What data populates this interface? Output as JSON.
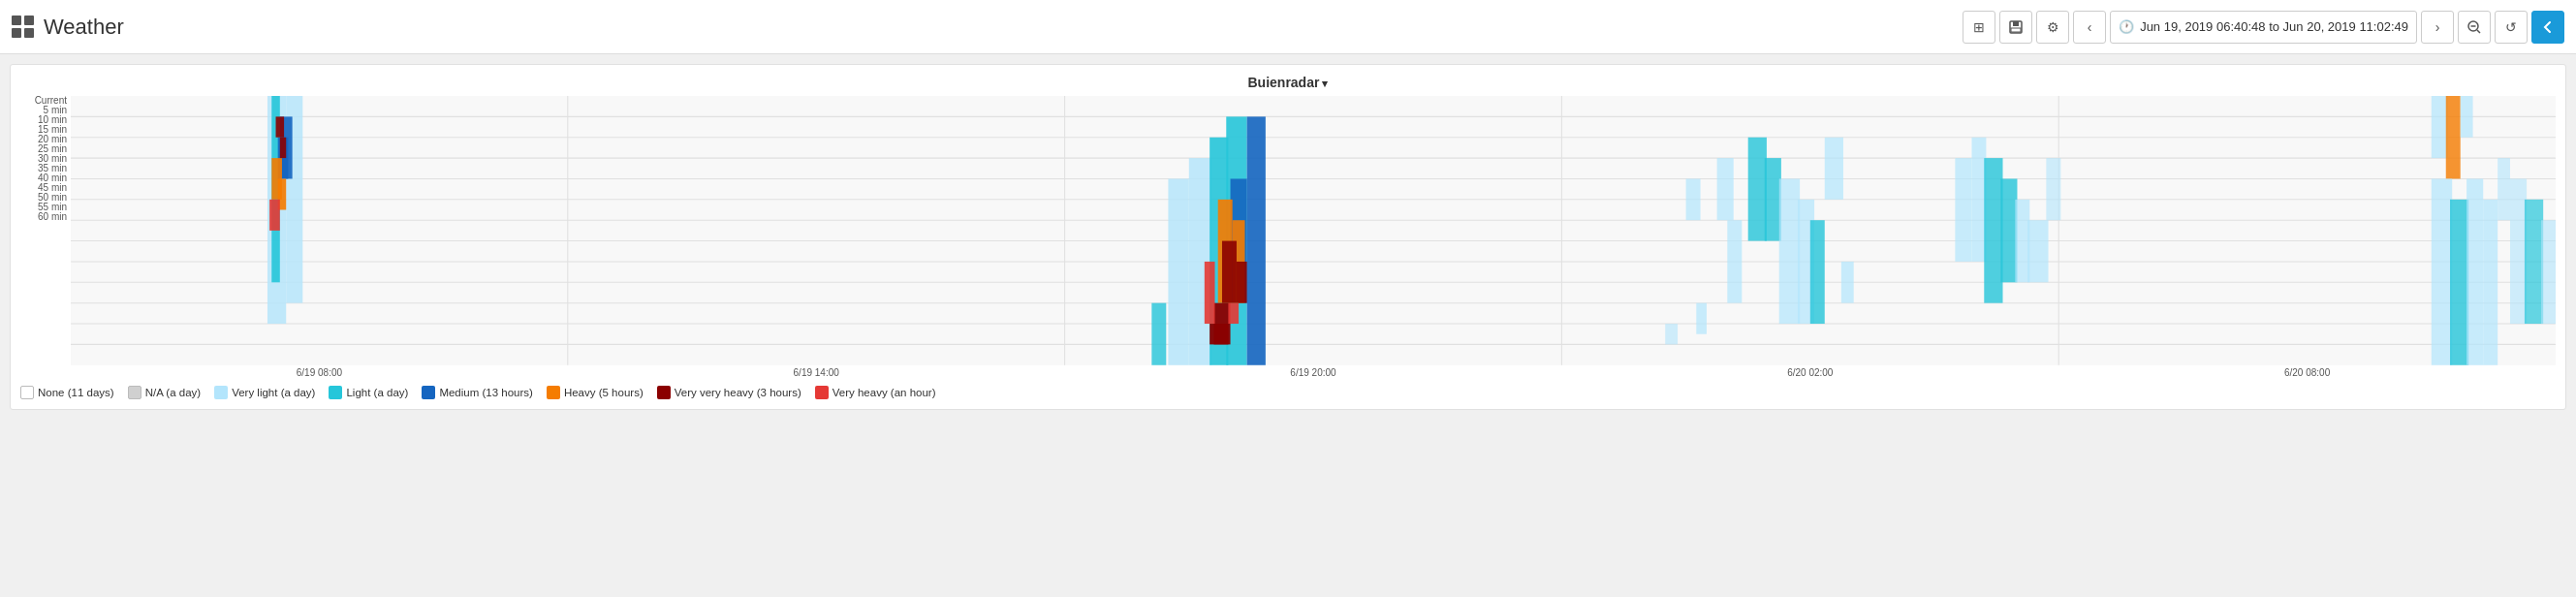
{
  "header": {
    "title": "Weather",
    "time_range": "Jun 19, 2019 06:40:48 to Jun 20, 2019 11:02:49",
    "buttons": {
      "prev": "‹",
      "next": "›",
      "zoom_out": "🔍",
      "refresh": "↺",
      "back": "↩",
      "save": "💾",
      "settings": "⚙",
      "panel": "▦"
    }
  },
  "chart": {
    "title": "Buienradar",
    "y_labels": [
      "Current",
      "5 min",
      "10 min",
      "15 min",
      "20 min",
      "25 min",
      "30 min",
      "35 min",
      "40 min",
      "45 min",
      "50 min",
      "55 min",
      "60 min"
    ],
    "x_labels": [
      "6/19 08:00",
      "6/19 14:00",
      "6/19 20:00",
      "6/20 02:00",
      "6/20 08:00"
    ],
    "legend": [
      {
        "label": "None (11 days)",
        "color": "#ffffff",
        "border": "#ccc"
      },
      {
        "label": "N/A (a day)",
        "color": "#d0d0d0",
        "border": "#bbb"
      },
      {
        "label": "Very light (a day)",
        "color": "#b3e5fc"
      },
      {
        "label": "Light (a day)",
        "color": "#26c6da"
      },
      {
        "label": "Medium (13 hours)",
        "color": "#1565c0"
      },
      {
        "label": "Heavy (5 hours)",
        "color": "#f57c00"
      },
      {
        "label": "Very very heavy (3 hours)",
        "color": "#8b0000"
      },
      {
        "label": "Very heavy (an hour)",
        "color": "#e53935"
      }
    ]
  }
}
